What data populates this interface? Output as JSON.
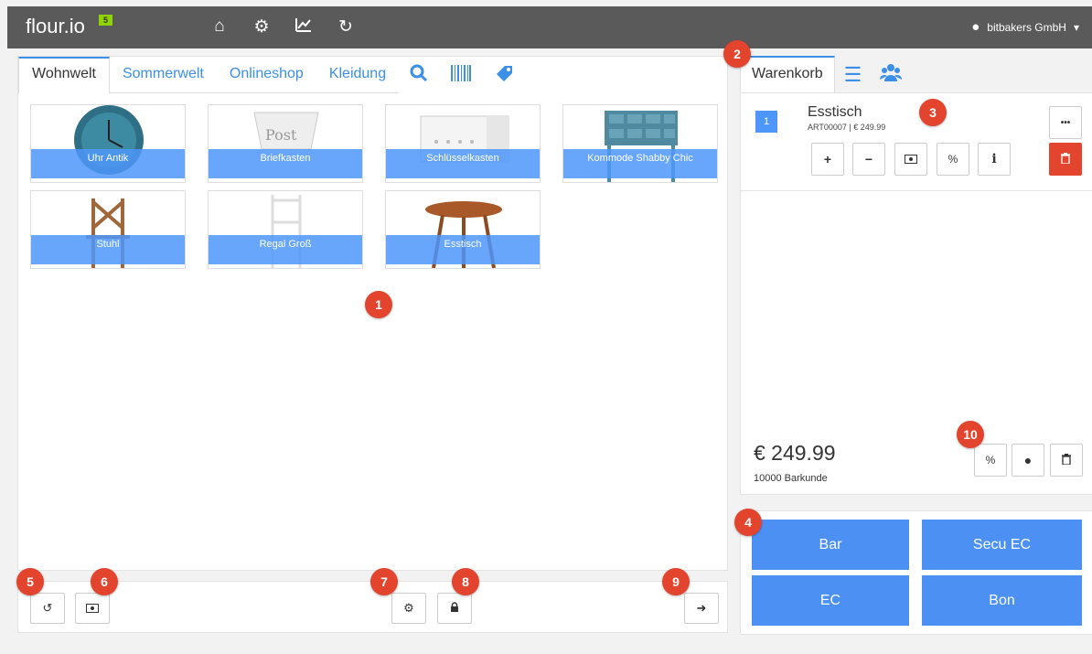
{
  "app": {
    "logo_text": "flour.io",
    "logo_mark": "5"
  },
  "topbar": {
    "icons": [
      "home-icon",
      "gear-icon",
      "chart-icon",
      "refresh-icon"
    ],
    "user": "bitbakers GmbH"
  },
  "tabs": [
    {
      "label": "Wohnwelt",
      "active": true
    },
    {
      "label": "Sommerwelt"
    },
    {
      "label": "Onlineshop"
    },
    {
      "label": "Kleidung"
    }
  ],
  "tab_icons": [
    "search-icon",
    "barcode-icon",
    "tag-icon"
  ],
  "products": [
    {
      "label": "Uhr Antik"
    },
    {
      "label": "Briefkasten"
    },
    {
      "label": "Schlüsselkasten"
    },
    {
      "label": "Kommode Shabby Chic"
    },
    {
      "label": "Stuhl"
    },
    {
      "label": "Regal Groß"
    },
    {
      "label": "Esstisch"
    }
  ],
  "cart": {
    "tab_label": "Warenkorb",
    "item": {
      "qty": "1",
      "name": "Esstisch",
      "meta": "ART00007 | € 249.99"
    },
    "total": "€ 249.99",
    "customer": "10000 Barkunde",
    "item_buttons": {
      "more": "•••",
      "plus": "+",
      "minus": "−",
      "percent": "%",
      "info": "i"
    },
    "footer_percent": "%"
  },
  "payment": {
    "bar": "Bar",
    "secu_ec": "Secu EC",
    "ec": "EC",
    "bon": "Bon"
  },
  "badges": [
    "1",
    "2",
    "3",
    "4",
    "5",
    "6",
    "7",
    "8",
    "9",
    "10"
  ],
  "colors": {
    "accent": "#4d96fa",
    "topbar": "#5a5a5a",
    "danger": "#e2442e",
    "logo_mark": "#8fd400"
  }
}
